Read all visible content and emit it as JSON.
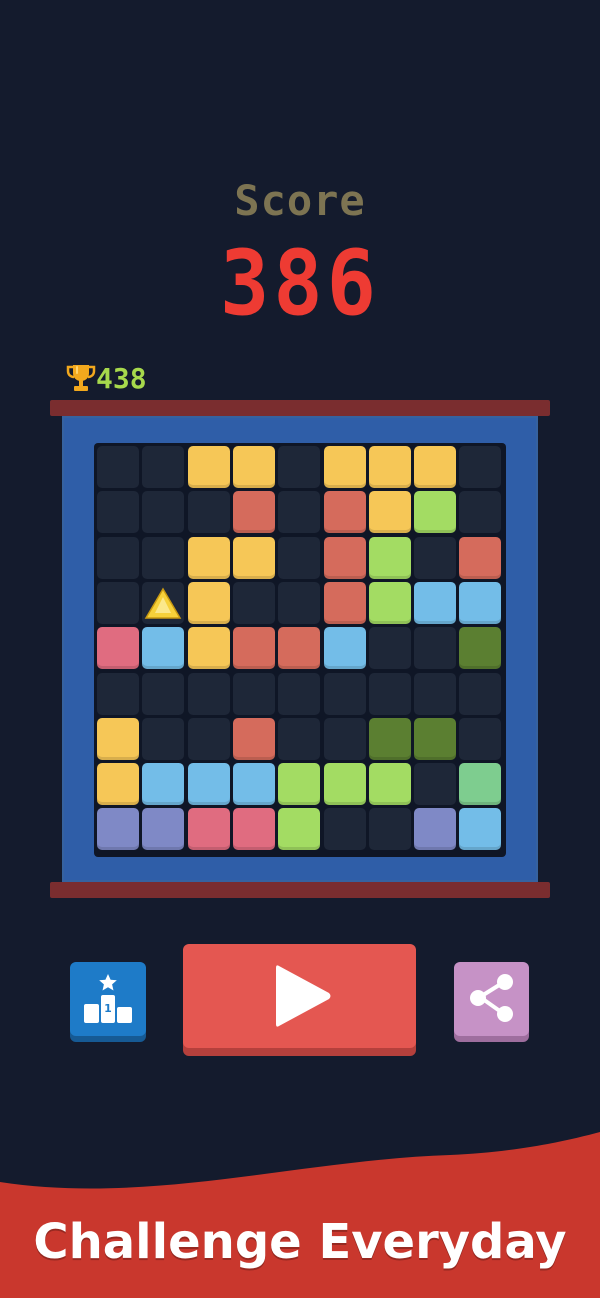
{
  "score": {
    "label": "Score",
    "value": "386"
  },
  "best": {
    "icon": "trophy-icon",
    "value": "438"
  },
  "colors": {
    "empty": "#1e2738",
    "yellow": "#f6c757",
    "salmon": "#d56b5c",
    "lightgreen": "#a3dc63",
    "blue": "#73bde8",
    "pink": "#e06c80",
    "darkgreen": "#5b7f31",
    "lavender": "#7f89c6",
    "mint": "#7ecd8f",
    "gem": "#f6d13a"
  },
  "board": {
    "rows": 9,
    "cols": 9,
    "cells": [
      [
        "empty",
        "empty",
        "yellow",
        "yellow",
        "empty",
        "yellow",
        "yellow",
        "yellow",
        "empty"
      ],
      [
        "empty",
        "empty",
        "empty",
        "salmon",
        "empty",
        "salmon",
        "yellow",
        "lightgreen",
        "empty"
      ],
      [
        "empty",
        "empty",
        "yellow",
        "yellow",
        "empty",
        "salmon",
        "lightgreen",
        "empty",
        "salmon"
      ],
      [
        "empty",
        "gem",
        "yellow",
        "empty",
        "empty",
        "salmon",
        "lightgreen",
        "blue",
        "blue"
      ],
      [
        "pink",
        "blue",
        "yellow",
        "salmon",
        "salmon",
        "blue",
        "empty",
        "empty",
        "darkgreen"
      ],
      [
        "empty",
        "empty",
        "empty",
        "empty",
        "empty",
        "empty",
        "empty",
        "empty",
        "empty"
      ],
      [
        "yellow",
        "empty",
        "empty",
        "salmon",
        "empty",
        "empty",
        "darkgreen",
        "darkgreen",
        "empty"
      ],
      [
        "yellow",
        "blue",
        "blue",
        "blue",
        "lightgreen",
        "lightgreen",
        "lightgreen",
        "empty",
        "mint"
      ],
      [
        "lavender",
        "lavender",
        "pink",
        "pink",
        "lightgreen",
        "empty",
        "empty",
        "lavender",
        "blue"
      ]
    ]
  },
  "buttons": {
    "leaderboard_icon": "podium-star-icon",
    "play_icon": "play-icon",
    "share_icon": "share-icon"
  },
  "banner": {
    "text": "Challenge Everyday"
  }
}
